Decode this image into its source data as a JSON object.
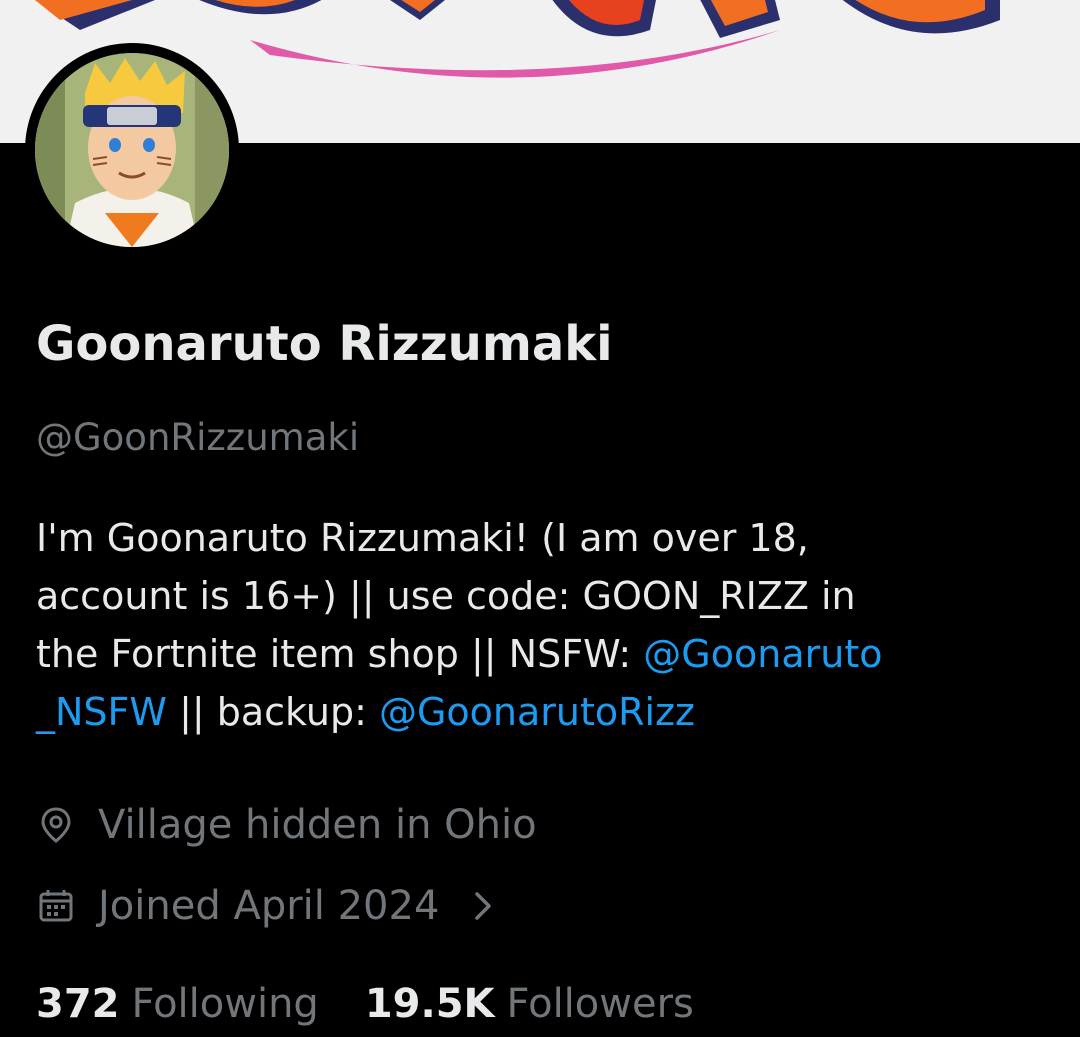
{
  "banner": {
    "image": "naruto-logo-banner",
    "colors": {
      "background": "#f1f1f1",
      "orange": "#f26f21",
      "red": "#e8411e",
      "navy": "#2b2f6c",
      "pink": "#e05aa9"
    }
  },
  "profile": {
    "avatar": "naruto-avatar",
    "display_name": "Goonaruto Rizzumaki",
    "handle": "@GoonRizzumaki",
    "bio": {
      "line1": "I'm Goonaruto Rizzumaki! (I am over 18,",
      "line2": "account is 16+) || use code: GOON_RIZZ in",
      "line3_text": "the Fortnite item shop || NSFW: ",
      "mention1_part1": "@Goonaruto",
      "mention1_part2": "_NSFW",
      "line4_text": " || backup: ",
      "mention2": "@GoonarutoRizz"
    },
    "location": "Village hidden in Ohio",
    "location_icon": "location-pin-icon",
    "joined": "Joined April 2024",
    "joined_icon": "calendar-icon",
    "following_count": "372",
    "following_label": "Following",
    "followers_count": "19.5K",
    "followers_label": "Followers"
  },
  "theme": {
    "background": "#000000",
    "text_primary": "#e7e9ea",
    "text_secondary": "#71767b",
    "link": "#1d9bf0"
  }
}
